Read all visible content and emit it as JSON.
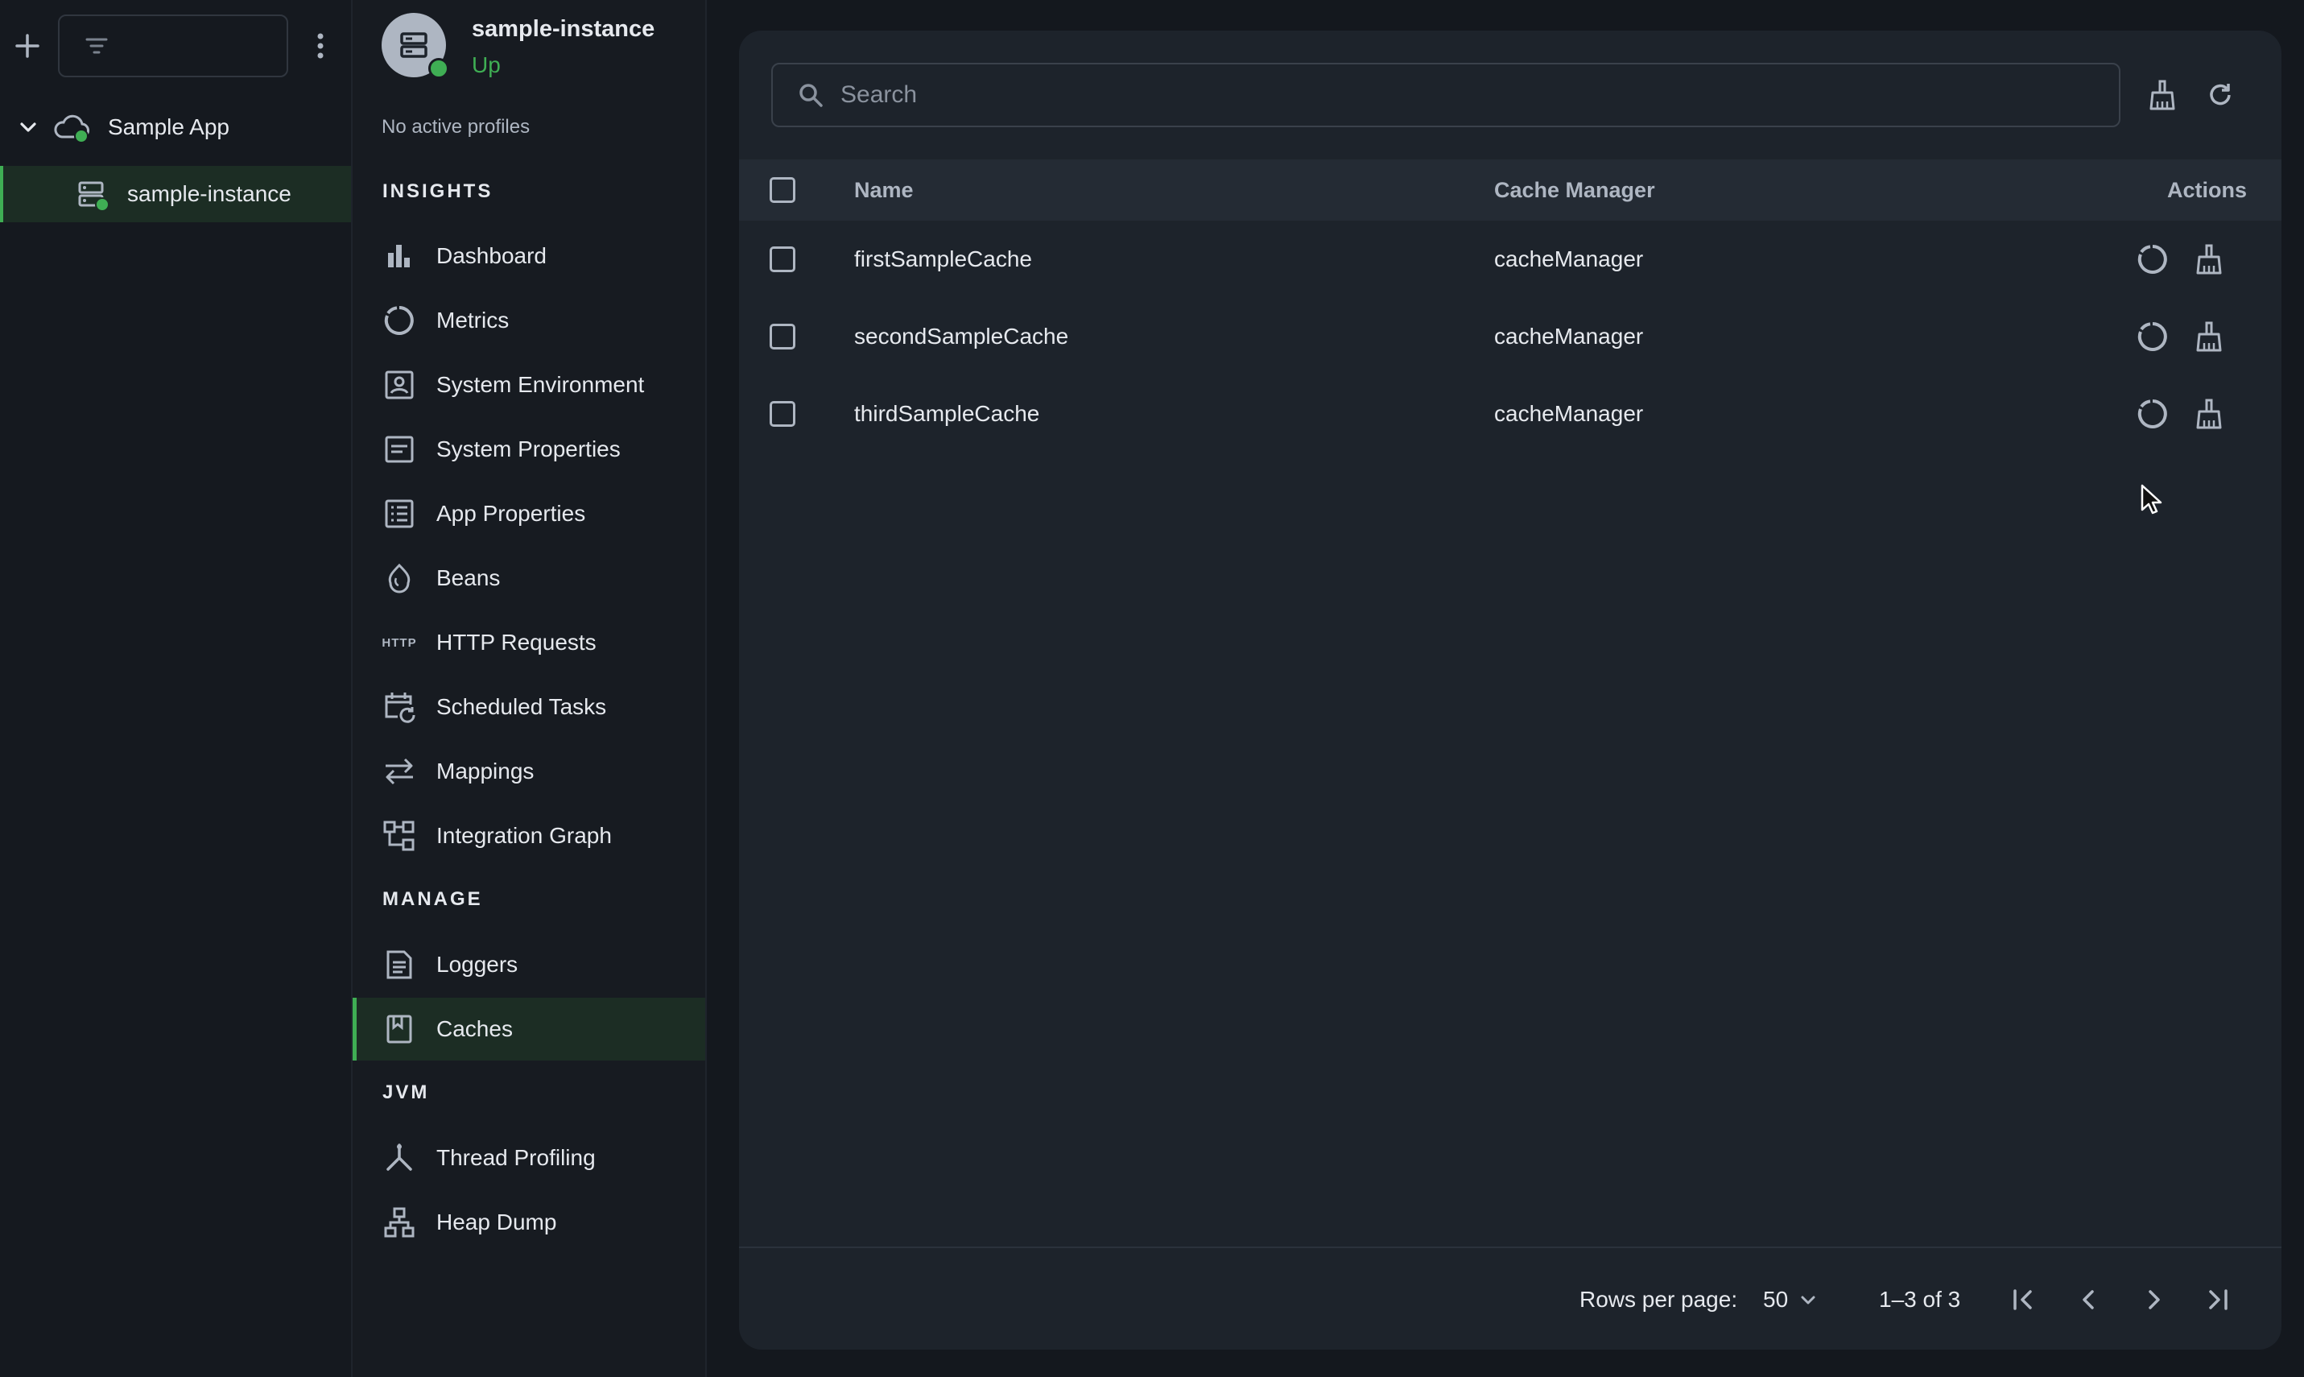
{
  "tree": {
    "app_name": "Sample App",
    "instance_name": "sample-instance"
  },
  "instance": {
    "name": "sample-instance",
    "status": "Up",
    "profiles": "No active profiles"
  },
  "nav": {
    "insights_title": "INSIGHTS",
    "insights": [
      {
        "label": "Dashboard",
        "icon": "bar-chart-icon"
      },
      {
        "label": "Metrics",
        "icon": "donut-icon"
      },
      {
        "label": "System Environment",
        "icon": "environment-icon"
      },
      {
        "label": "System Properties",
        "icon": "properties-icon"
      },
      {
        "label": "App Properties",
        "icon": "list-icon"
      },
      {
        "label": "Beans",
        "icon": "bean-icon"
      },
      {
        "label": "HTTP Requests",
        "icon": "http-icon"
      },
      {
        "label": "Scheduled Tasks",
        "icon": "calendar-refresh-icon"
      },
      {
        "label": "Mappings",
        "icon": "swap-arrows-icon"
      },
      {
        "label": "Integration Graph",
        "icon": "graph-icon"
      }
    ],
    "manage_title": "MANAGE",
    "manage": [
      {
        "label": "Loggers",
        "icon": "document-icon"
      },
      {
        "label": "Caches",
        "icon": "bookmark-icon",
        "active": true
      }
    ],
    "jvm_title": "JVM",
    "jvm": [
      {
        "label": "Thread Profiling",
        "icon": "fork-icon"
      },
      {
        "label": "Heap Dump",
        "icon": "hierarchy-icon"
      }
    ],
    "http_badge": "HTTP"
  },
  "search": {
    "placeholder": "Search"
  },
  "table": {
    "columns": {
      "name": "Name",
      "cache_manager": "Cache Manager",
      "actions": "Actions"
    },
    "rows": [
      {
        "name": "firstSampleCache",
        "cache_manager": "cacheManager"
      },
      {
        "name": "secondSampleCache",
        "cache_manager": "cacheManager"
      },
      {
        "name": "thirdSampleCache",
        "cache_manager": "cacheManager"
      }
    ]
  },
  "footer": {
    "rows_per_page_label": "Rows per page:",
    "rows_per_page_value": "50",
    "range": "1–3 of 3"
  },
  "colors": {
    "accent": "#3fae54",
    "background": "#14181e",
    "card": "#1d232b"
  }
}
